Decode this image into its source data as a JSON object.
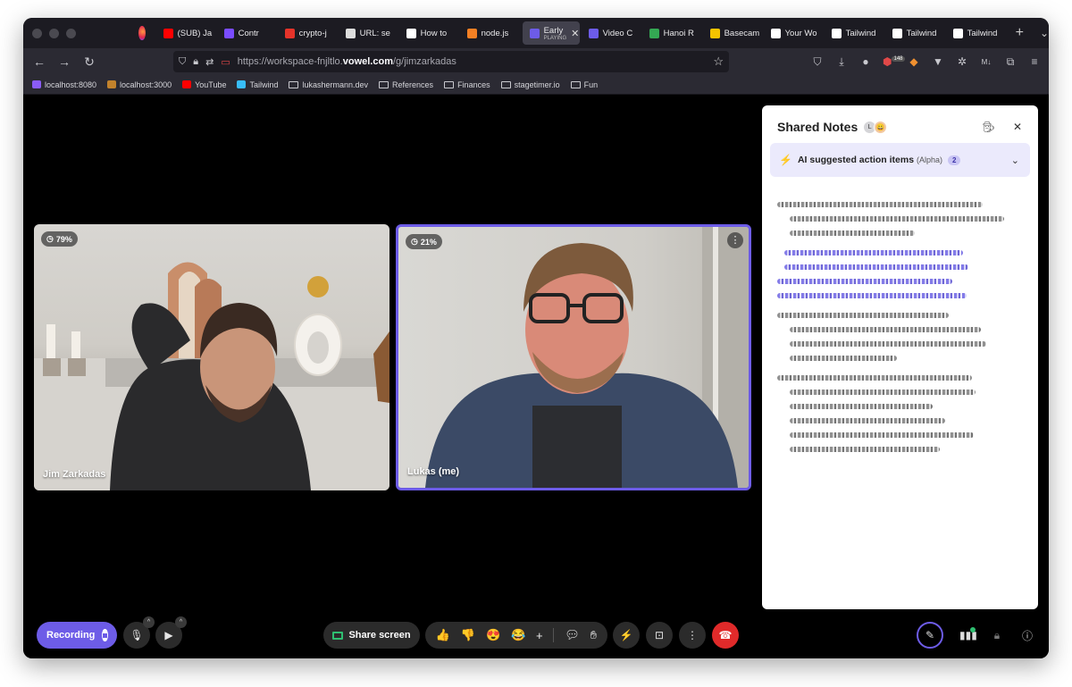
{
  "browser": {
    "tabs": [
      {
        "label": "(SUB) Ja",
        "color": "#ff0000"
      },
      {
        "label": "Contr",
        "color": "#7a4cff"
      },
      {
        "label": "crypto-j",
        "color": "#e5332a"
      },
      {
        "label": "URL: se",
        "color": "#dddddd"
      },
      {
        "label": "How to",
        "color": "#ffffff"
      },
      {
        "label": "node.js",
        "color": "#f48024"
      },
      {
        "label": "Early",
        "sub": "PLAYING",
        "color": "#6d5ce7",
        "active": true
      },
      {
        "label": "Video C",
        "color": "#6d5ce7"
      },
      {
        "label": "Hanoi R",
        "color": "#34a853"
      },
      {
        "label": "Basecam",
        "color": "#f5c400"
      },
      {
        "label": "Your Wo",
        "color": "#ffffff"
      },
      {
        "label": "Tailwind",
        "color": "#ffffff"
      },
      {
        "label": "Tailwind",
        "color": "#ffffff"
      },
      {
        "label": "Tailwind",
        "color": "#ffffff"
      }
    ],
    "url_prefix": "https://workspace-fnjltlo.",
    "url_domain": "vowel.com",
    "url_path": "/g/jimzarkadas",
    "badge_count": "148",
    "bookmarks": [
      {
        "label": "localhost:8080",
        "type": "site"
      },
      {
        "label": "localhost:3000",
        "type": "site"
      },
      {
        "label": "YouTube",
        "type": "site"
      },
      {
        "label": "Tailwind",
        "type": "site"
      },
      {
        "label": "lukashermann.dev",
        "type": "folder"
      },
      {
        "label": "References",
        "type": "folder"
      },
      {
        "label": "Finances",
        "type": "folder"
      },
      {
        "label": "stagetimer.io",
        "type": "folder"
      },
      {
        "label": "Fun",
        "type": "folder"
      }
    ]
  },
  "participants": [
    {
      "name": "Jim Zarkadas",
      "talk_share": "79%"
    },
    {
      "name": "Lukas (me)",
      "talk_share": "21%"
    }
  ],
  "notes": {
    "title": "Shared Notes",
    "avatar_initial": "L",
    "ai_label": "AI suggested action items",
    "ai_sub": "(Alpha)",
    "ai_count": "2"
  },
  "controls": {
    "recording_label": "Recording",
    "share_label": "Share screen",
    "reactions": [
      "👍",
      "👎",
      "😍",
      "😂"
    ]
  },
  "colors": {
    "accent": "#6d5ce7",
    "hangup": "#e02a2a",
    "share_icon": "#2fbf71"
  }
}
